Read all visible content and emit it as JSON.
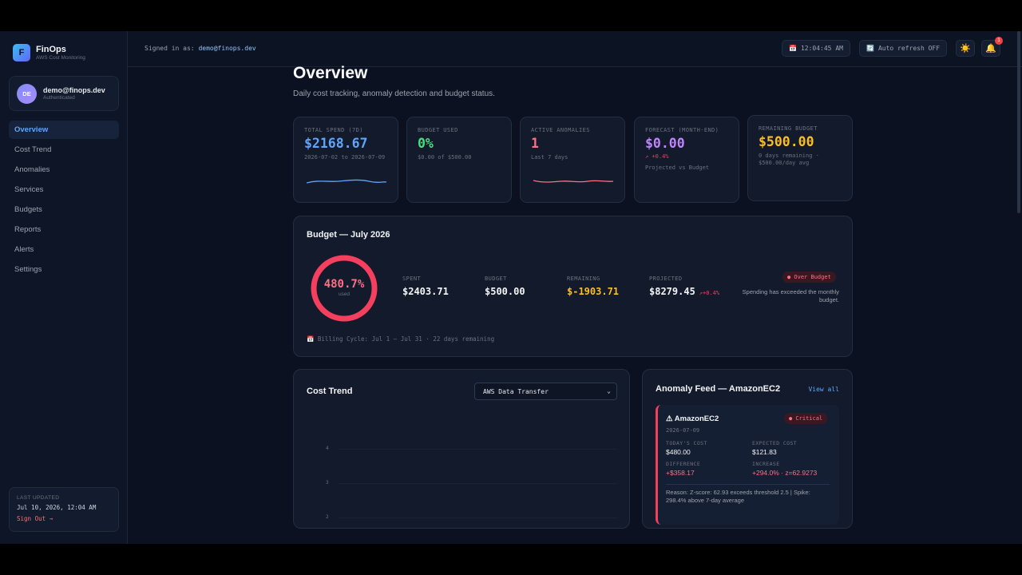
{
  "brand": {
    "name": "FinOps",
    "subtitle": "AWS Cost Monitoring",
    "logo_letter": "F"
  },
  "user": {
    "initials": "DE",
    "email": "demo@finops.dev",
    "status": "Authenticated"
  },
  "nav": [
    "Overview",
    "Cost Trend",
    "Anomalies",
    "Services",
    "Budgets",
    "Reports",
    "Alerts",
    "Settings"
  ],
  "sidebar_footer": {
    "label": "LAST UPDATED",
    "value": "Jul 10, 2026, 12:04 AM",
    "signout": "Sign Out →"
  },
  "topbar": {
    "signed_prefix": "Signed in as:",
    "signed_email": "demo@finops.dev",
    "time": "12:04:45 AM",
    "auto_refresh": "Auto refresh OFF",
    "notifications": "1"
  },
  "page": {
    "title": "Overview",
    "subtitle": "Daily cost tracking, anomaly detection and budget status."
  },
  "kpis": [
    {
      "label": "TOTAL SPEND (7D)",
      "value": "$2168.67",
      "note": "2026-07-02 to 2026-07-09",
      "color": "#60a5fa"
    },
    {
      "label": "BUDGET USED",
      "value": "0%",
      "note": "$0.00 of $500.00",
      "color": "#4ade80"
    },
    {
      "label": "ACTIVE ANOMALIES",
      "value": "1",
      "note": "Last 7 days",
      "color": "#fb7185"
    },
    {
      "label": "FORECAST (MONTH-END)",
      "value": "$0.00",
      "trend": "↗ +0.4%",
      "note": "Projected vs Budget",
      "color": "#c084fc"
    },
    {
      "label": "REMAINING BUDGET",
      "value": "$500.00",
      "note": "0 days remaining · $500.00/day avg",
      "color": "#fbbf24"
    }
  ],
  "budget": {
    "title": "Budget — July 2026",
    "used_pct_label": "480.7%",
    "used_label": "used",
    "used_fraction": 1,
    "stats": [
      {
        "label": "SPENT",
        "value": "$2403.71"
      },
      {
        "label": "BUDGET",
        "value": "$500.00"
      },
      {
        "label": "REMAINING",
        "value": "$-1903.71"
      },
      {
        "label": "PROJECTED",
        "value": "$8279.45",
        "delta": "↗+0.4%"
      }
    ],
    "badge": "● Over Budget",
    "note": "Spending has exceeded the monthly budget.",
    "billing": "📅 Billing Cycle: Jul 1 – Jul 31 · 22 days remaining"
  },
  "cost_trend": {
    "title": "Cost Trend",
    "selected_service": "AWS Data Transfer",
    "y_ticks": [
      "4",
      "3",
      "2"
    ]
  },
  "anomaly_feed": {
    "title": "Anomaly Feed — AmazonEC2",
    "view_all": "View all",
    "item": {
      "service": "⚠ AmazonEC2",
      "severity": "● Critical",
      "date": "2026-07-09",
      "todays_cost_label": "TODAY'S COST",
      "todays_cost": "$480.00",
      "expected_label": "EXPECTED COST",
      "expected": "$121.83",
      "diff_label": "DIFFERENCE",
      "diff": "+$358.17",
      "increase_label": "INCREASE",
      "increase": "+294.0% · z=62.9273",
      "reason": "Reason: Z-score: 62.93 exceeds threshold 2.5 | Spike: 298.4% above 7-day average"
    }
  }
}
